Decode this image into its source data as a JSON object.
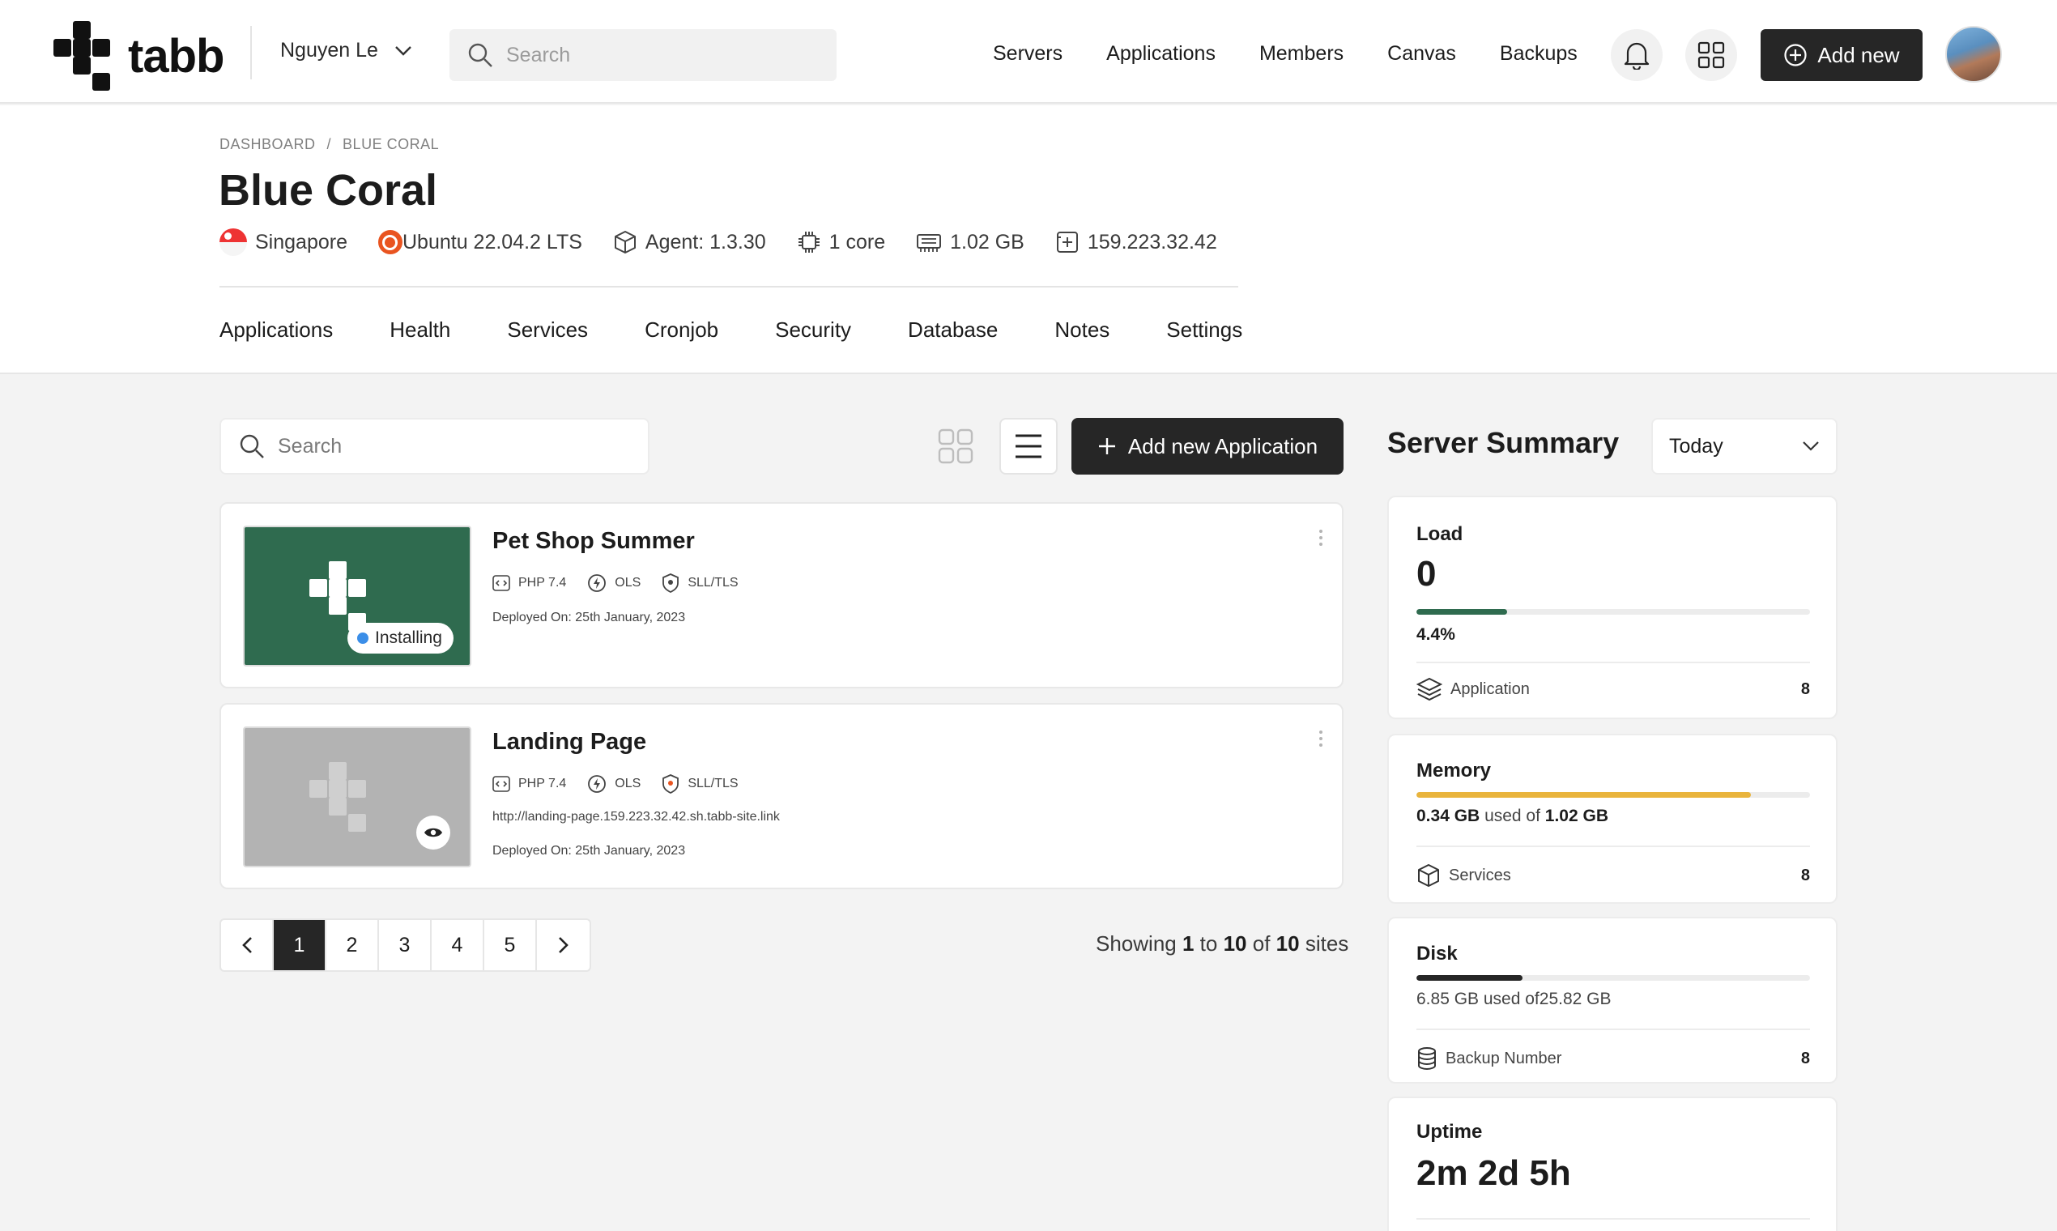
{
  "brand": {
    "name": "tabb"
  },
  "topnav": {
    "team": "Nguyen Le",
    "search_placeholder": "Search",
    "links": [
      "Servers",
      "Applications",
      "Members",
      "Canvas",
      "Backups"
    ],
    "add_new": "Add new"
  },
  "breadcrumb": {
    "root": "DASHBOARD",
    "separator": "/",
    "current": "BLUE CORAL"
  },
  "server": {
    "name": "Blue Coral",
    "location": "Singapore",
    "os": "Ubuntu 22.04.2 LTS",
    "agent": "Agent: 1.3.30",
    "cpu": "1 core",
    "ram": "1.02 GB",
    "ip": "159.223.32.42"
  },
  "tabs": [
    "Applications",
    "Health",
    "Services",
    "Cronjob",
    "Security",
    "Database",
    "Notes",
    "Settings"
  ],
  "apps_toolbar": {
    "search_placeholder": "Search",
    "add_button": "Add new Application"
  },
  "apps": [
    {
      "name": "Pet Shop Summer",
      "php": "PHP 7.4",
      "server": "OLS",
      "ssl": "SLL/TLS",
      "status": "Installing",
      "url": "",
      "deployed": "Deployed On: 25th January, 2023"
    },
    {
      "name": "Landing Page",
      "php": "PHP 7.4",
      "server": "OLS",
      "ssl": "SLL/TLS",
      "status": "",
      "url": "http://landing-page.159.223.32.42.sh.tabb-site.link",
      "deployed": "Deployed On: 25th January, 2023"
    }
  ],
  "pagination": {
    "pages": [
      "1",
      "2",
      "3",
      "4",
      "5"
    ],
    "current": "1",
    "showing": {
      "prefix": "Showing",
      "from": "1",
      "to_word": "to",
      "to": "10",
      "of_word": "of",
      "total": "10",
      "suffix": "sites"
    }
  },
  "summary": {
    "title": "Server Summary",
    "period": "Today",
    "load": {
      "label": "Load",
      "value": "0",
      "percent_text": "4.4%",
      "fill_pct": 23,
      "color": "#2f6b4f",
      "row_label": "Application",
      "row_count": "8"
    },
    "memory": {
      "label": "Memory",
      "used": "0.34 GB",
      "used_of": "used of",
      "total": "1.02 GB",
      "fill_pct": 85,
      "color": "#e9b43c",
      "row_label": "Services",
      "row_count": "8"
    },
    "disk": {
      "label": "Disk",
      "text": "6.85 GB used of25.82 GB",
      "fill_pct": 27,
      "color": "#262626",
      "row_label": "Backup Number",
      "row_count": "8"
    },
    "uptime": {
      "label": "Uptime",
      "value": "2m 2d 5h"
    }
  },
  "colors": {
    "accent_dark": "#262626",
    "installing_dot": "#3b8ee8",
    "thumb_green": "#2f6b4f"
  }
}
